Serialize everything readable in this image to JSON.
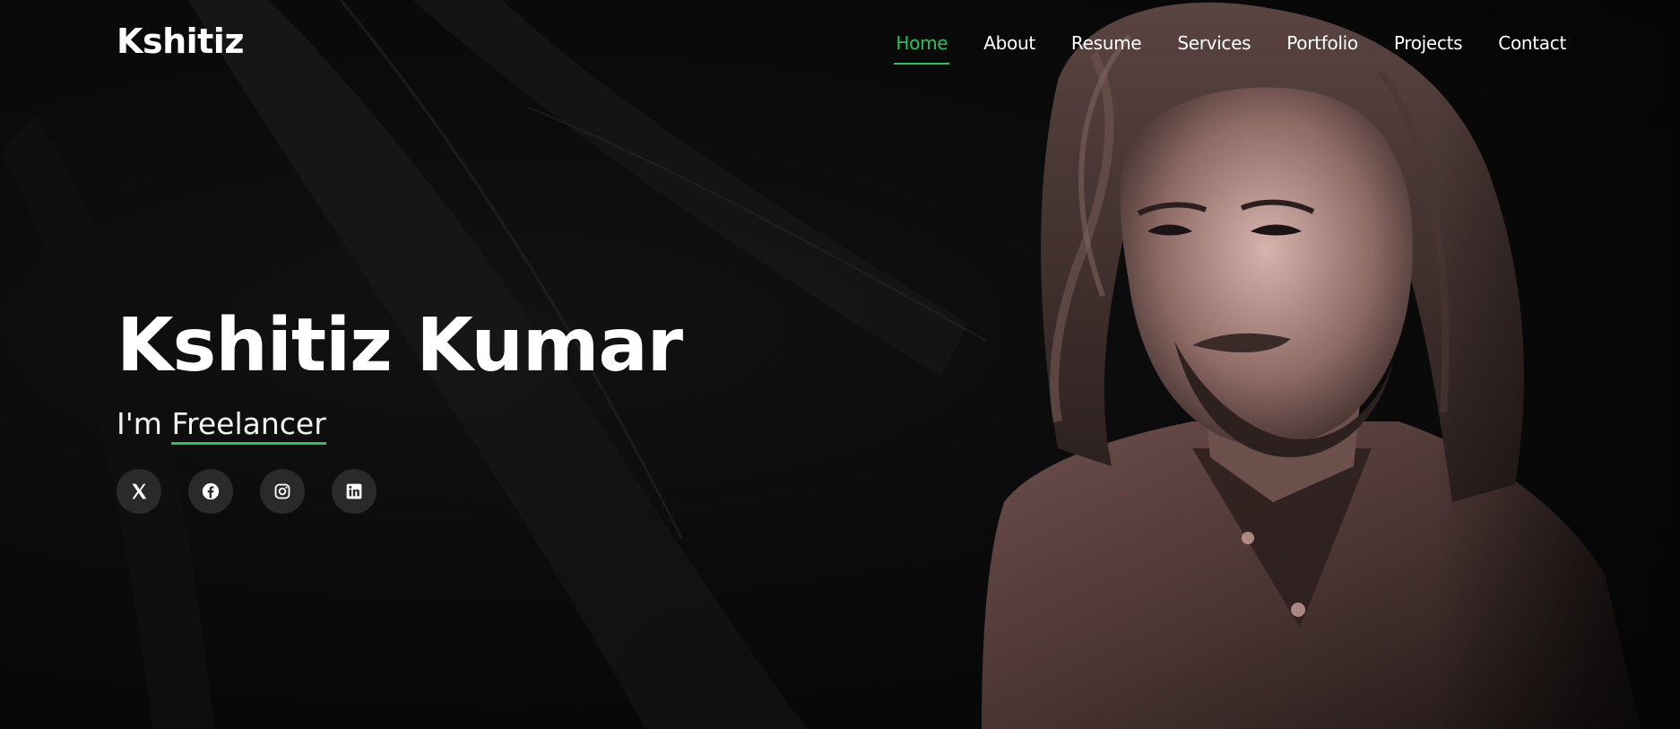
{
  "brand": {
    "logo": "Kshitiz"
  },
  "nav": {
    "items": [
      {
        "label": "Home",
        "active": true
      },
      {
        "label": "About"
      },
      {
        "label": "Resume"
      },
      {
        "label": "Services"
      },
      {
        "label": "Portfolio"
      },
      {
        "label": "Projects"
      },
      {
        "label": "Contact"
      }
    ]
  },
  "hero": {
    "name": "Kshitiz Kumar",
    "tagline_prefix": "I'm",
    "tagline_role": "Freelancer",
    "photo_icon": "portrait-photo"
  },
  "socials": [
    {
      "icon": "x-twitter-icon"
    },
    {
      "icon": "facebook-icon"
    },
    {
      "icon": "instagram-icon"
    },
    {
      "icon": "linkedin-icon"
    }
  ],
  "colors": {
    "accent": "#22c55e",
    "background": "#060606",
    "social_bg": "#2a2a2a",
    "portrait_tint": "#c9a19b"
  }
}
